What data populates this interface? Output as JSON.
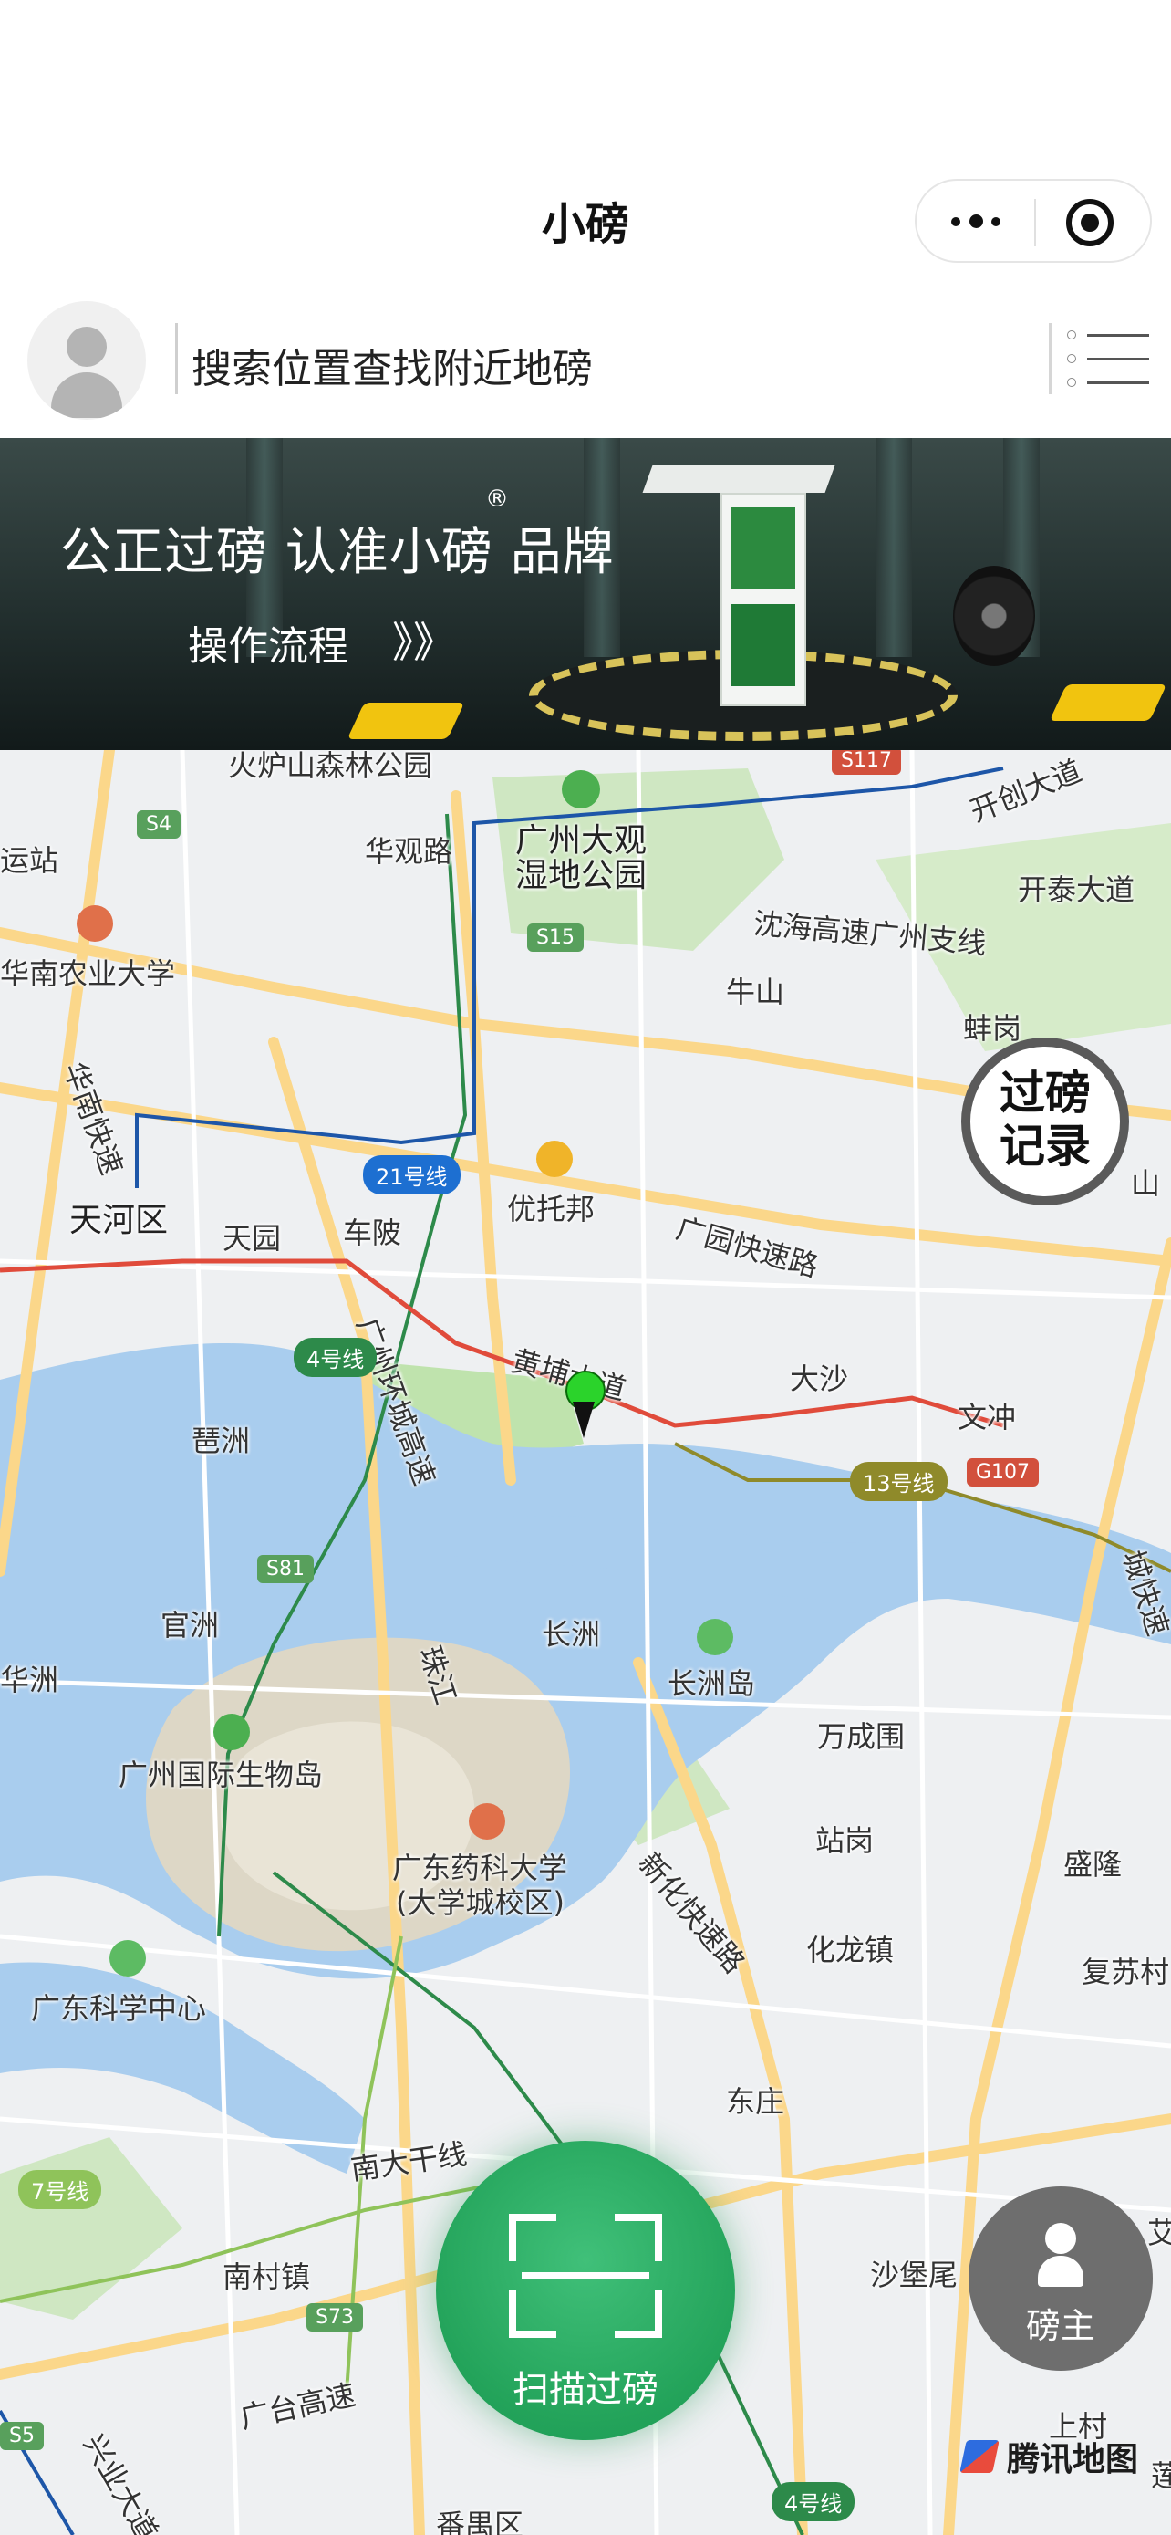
{
  "nav": {
    "title": "小磅",
    "more_icon": "more-dots-icon",
    "close_icon": "target-circle-icon"
  },
  "search": {
    "avatar_icon": "user-avatar-icon",
    "placeholder": "搜索位置查找附近地磅",
    "menu_icon": "list-menu-icon"
  },
  "banner": {
    "slogan": "公正过磅  认准小磅 品牌",
    "registered": "®",
    "link_label": "操作流程",
    "link_arrows": "》》",
    "accent": "#d8c35a"
  },
  "map": {
    "labels": [
      {
        "id": "huolushan",
        "text": "火炉山森林公园"
      },
      {
        "id": "huaguanlu",
        "text": "华观路"
      },
      {
        "id": "gzdg",
        "text": "广州大观"
      },
      {
        "id": "shidi",
        "text": "湿地公园"
      },
      {
        "id": "kaichuang",
        "text": "开创大道"
      },
      {
        "id": "kaitai",
        "text": "开泰大道"
      },
      {
        "id": "yunzhan",
        "text": "运站"
      },
      {
        "id": "hnny",
        "text": "华南农业大学"
      },
      {
        "id": "shenhai",
        "text": "沈海高速广州支线"
      },
      {
        "id": "niushan",
        "text": "牛山"
      },
      {
        "id": "banggang",
        "text": "蚌岗"
      },
      {
        "id": "huanan_ks",
        "text": "华南快速"
      },
      {
        "id": "tianhe",
        "text": "天河区"
      },
      {
        "id": "tianyuan",
        "text": "天园"
      },
      {
        "id": "chebei",
        "text": "车陂"
      },
      {
        "id": "youtuobang",
        "text": "优托邦"
      },
      {
        "id": "guangyuan",
        "text": "广园快速路"
      },
      {
        "id": "huanhuan",
        "text": "广州环城高速"
      },
      {
        "id": "huangpu",
        "text": "黄埔大道"
      },
      {
        "id": "dasha",
        "text": "大沙"
      },
      {
        "id": "wenchong",
        "text": "文冲"
      },
      {
        "id": "pazhou",
        "text": "琶洲"
      },
      {
        "id": "guanzhou",
        "text": "官洲"
      },
      {
        "id": "changzhou",
        "text": "长洲"
      },
      {
        "id": "changzhoudao",
        "text": "长洲岛"
      },
      {
        "id": "zhujiang",
        "text": "珠江"
      },
      {
        "id": "huazhou",
        "text": "华洲"
      },
      {
        "id": "wanchengwei",
        "text": "万成围"
      },
      {
        "id": "gzswd",
        "text": "广州国际生物岛"
      },
      {
        "id": "gdyk",
        "text": "广东药科大学"
      },
      {
        "id": "gdyk2",
        "text": "(大学城校区)"
      },
      {
        "id": "zhangang",
        "text": "站岗"
      },
      {
        "id": "shenglong",
        "text": "盛隆"
      },
      {
        "id": "xinhua",
        "text": "新化快速路"
      },
      {
        "id": "hualong",
        "text": "化龙镇"
      },
      {
        "id": "fusu",
        "text": "复苏村"
      },
      {
        "id": "gdkx",
        "text": "广东科学中心"
      },
      {
        "id": "dongzhuang",
        "text": "东庄"
      },
      {
        "id": "nandagan",
        "text": "南大干线"
      },
      {
        "id": "nancun",
        "text": "南村镇"
      },
      {
        "id": "shabao",
        "text": "沙堡尾"
      },
      {
        "id": "guangtai",
        "text": "广台高速"
      },
      {
        "id": "shangcun",
        "text": "上村"
      },
      {
        "id": "panyu",
        "text": "番禺区"
      },
      {
        "id": "shan",
        "text": "山"
      },
      {
        "id": "chengfast",
        "text": "城快速"
      },
      {
        "id": "ai",
        "text": "艾"
      },
      {
        "id": "lian",
        "text": "莲"
      },
      {
        "id": "xingye",
        "text": "兴业大道"
      }
    ],
    "badges": [
      {
        "id": "s117",
        "text": "S117"
      },
      {
        "id": "s4",
        "text": "S4"
      },
      {
        "id": "s15",
        "text": "S15"
      },
      {
        "id": "l21",
        "text": "21号线"
      },
      {
        "id": "l4a",
        "text": "4号线"
      },
      {
        "id": "s81",
        "text": "S81"
      },
      {
        "id": "l13",
        "text": "13号线"
      },
      {
        "id": "g107",
        "text": "G107"
      },
      {
        "id": "l7",
        "text": "7号线"
      },
      {
        "id": "s73",
        "text": "S73"
      },
      {
        "id": "s5",
        "text": "S5"
      },
      {
        "id": "l4b",
        "text": "4号线"
      }
    ],
    "pin_icon": "location-pin-icon",
    "attribution": "腾讯地图",
    "colors": {
      "water": "#a9cdee",
      "green": "#b7e0a5",
      "road": "#f7d58b"
    }
  },
  "buttons": {
    "record_line1": "过磅",
    "record_line2": "记录",
    "scan_label": "扫描过磅",
    "scan_icon": "scan-frame-icon",
    "owner_label": "磅主",
    "owner_icon": "headset-user-icon",
    "scan_color": "#23a35a"
  }
}
